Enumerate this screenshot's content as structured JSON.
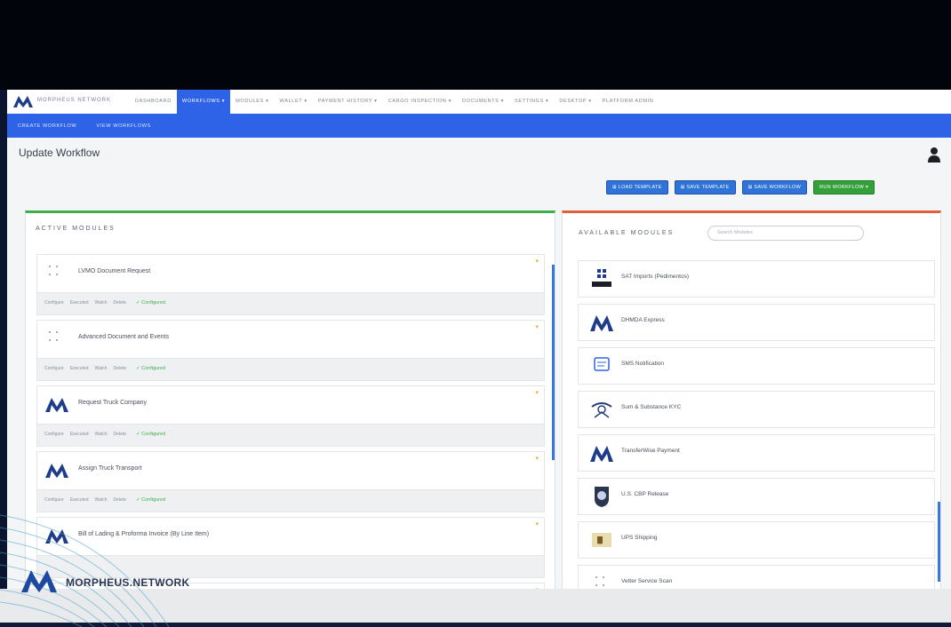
{
  "nav": {
    "brand": "Morpheus Network",
    "items": [
      {
        "label": "Dashboard",
        "active": false
      },
      {
        "label": "Workflows ▾",
        "active": true
      },
      {
        "label": "Modules ▾",
        "active": false
      },
      {
        "label": "Wallet ▾",
        "active": false
      },
      {
        "label": "Payment History ▾",
        "active": false
      },
      {
        "label": "Cargo Inspection ▾",
        "active": false
      },
      {
        "label": "Documents ▾",
        "active": false
      },
      {
        "label": "Settings ▾",
        "active": false
      },
      {
        "label": "Desktop ▾",
        "active": false
      },
      {
        "label": "Platform Admin",
        "active": false
      }
    ],
    "sub_items": [
      "Create Workflow",
      "View Workflows"
    ]
  },
  "page": {
    "title": "Update Workflow"
  },
  "actions": {
    "load_template": "⊞ Load Template",
    "save_template": "⊞ Save Template",
    "save_workflow": "⊞ Save Workflow",
    "run_workflow": "Run Workflow ▾"
  },
  "active_modules": {
    "title": "Active Modules",
    "items": [
      {
        "name": "LVMO Document Request",
        "icon": "drag-handle-icon",
        "tabs": [
          "Configure",
          "Executed",
          "Watch",
          "Delete"
        ],
        "status": "✓ Configured"
      },
      {
        "name": "Advanced Document and Events",
        "icon": "drag-handle-icon",
        "tabs": [
          "Configure",
          "Executed",
          "Watch",
          "Delete"
        ],
        "status": "✓ Configured"
      },
      {
        "name": "Request Truck Company",
        "icon": "morpheus-logo-icon",
        "tabs": [
          "Configure",
          "Executed",
          "Watch",
          "Delete"
        ],
        "status": "✓ Configured"
      },
      {
        "name": "Assign Truck Transport",
        "icon": "morpheus-logo-icon",
        "tabs": [
          "Configure",
          "Executed",
          "Watch",
          "Delete"
        ],
        "status": "✓ Configured"
      },
      {
        "name": "Bill of Lading & Proforma Invoice (By Line Item)",
        "icon": "morpheus-logo-icon",
        "tabs": [],
        "status": ""
      }
    ]
  },
  "available_modules": {
    "title": "Available Modules",
    "search_placeholder": "Search Modules",
    "items": [
      {
        "name": "SAT Imports (Pedimentos)",
        "icon": "sat-logo-icon"
      },
      {
        "name": "DHMDA Express",
        "icon": "morpheus-logo-icon"
      },
      {
        "name": "SMS Notification",
        "icon": "sms-icon"
      },
      {
        "name": "Sum & Substance KYC",
        "icon": "sumsub-logo-icon"
      },
      {
        "name": "TransferWise Payment",
        "icon": "morpheus-logo-icon"
      },
      {
        "name": "U.S. CBP Release",
        "icon": "cbp-seal-icon"
      },
      {
        "name": "UPS Shipping",
        "icon": "ups-logo-icon"
      },
      {
        "name": "Vetter Service Scan",
        "icon": "drag-handle-icon"
      }
    ]
  },
  "watermark": {
    "text": "MORPHEUS.NETWORK"
  },
  "colors": {
    "primary": "#2e63e8",
    "success": "#3fae49",
    "accent": "#e0603a"
  }
}
